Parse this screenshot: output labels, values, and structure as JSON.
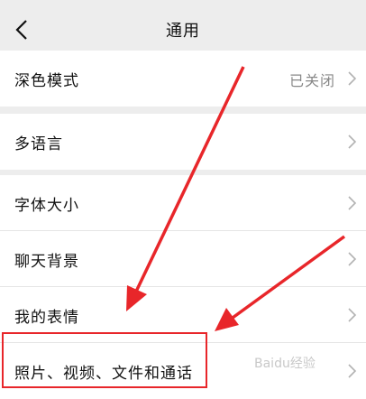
{
  "nav": {
    "title": "通用",
    "back_icon": "chevron-left-icon"
  },
  "groups": [
    {
      "rows": [
        {
          "label": "深色模式",
          "value": "已关闭"
        }
      ]
    },
    {
      "rows": [
        {
          "label": "多语言"
        }
      ]
    },
    {
      "rows": [
        {
          "label": "字体大小"
        },
        {
          "label": "聊天背景"
        },
        {
          "label": "我的表情"
        },
        {
          "label": "照片、视频、文件和通话"
        }
      ]
    }
  ],
  "annotation": {
    "highlight_color": "#e8262a",
    "watermark": "Baidu经验"
  },
  "colors": {
    "background": "#ededed",
    "text": "#111111",
    "muted": "#888888"
  }
}
